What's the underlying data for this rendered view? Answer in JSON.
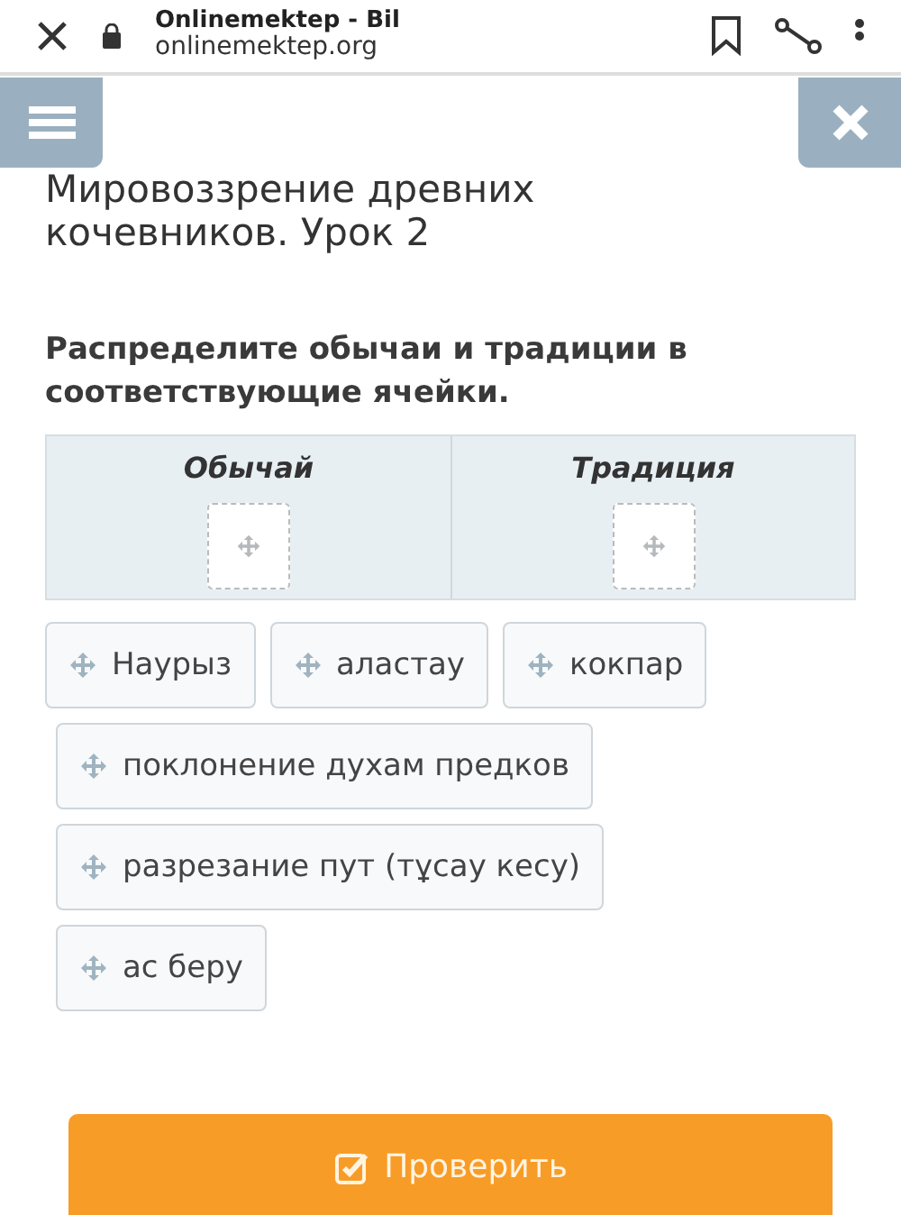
{
  "browser_bar": {
    "title": "Onlinemektep - Bil",
    "url": "onlinemektep.org"
  },
  "title": "Мировоззрение древних кочевников. Урок 2",
  "instruction": "Распределите обычаи и традиции в соответствующие ячейки.",
  "table": {
    "columns": [
      "Обычай",
      "Традиция"
    ]
  },
  "chips": [
    {
      "label": "Наурыз"
    },
    {
      "label": "аластау"
    },
    {
      "label": "кокпар"
    },
    {
      "label": "поклонение духам предков"
    },
    {
      "label": "разрезание пут (тұсау кесу)"
    },
    {
      "label": "ас беру"
    }
  ],
  "check_button": {
    "label": "Проверить"
  }
}
